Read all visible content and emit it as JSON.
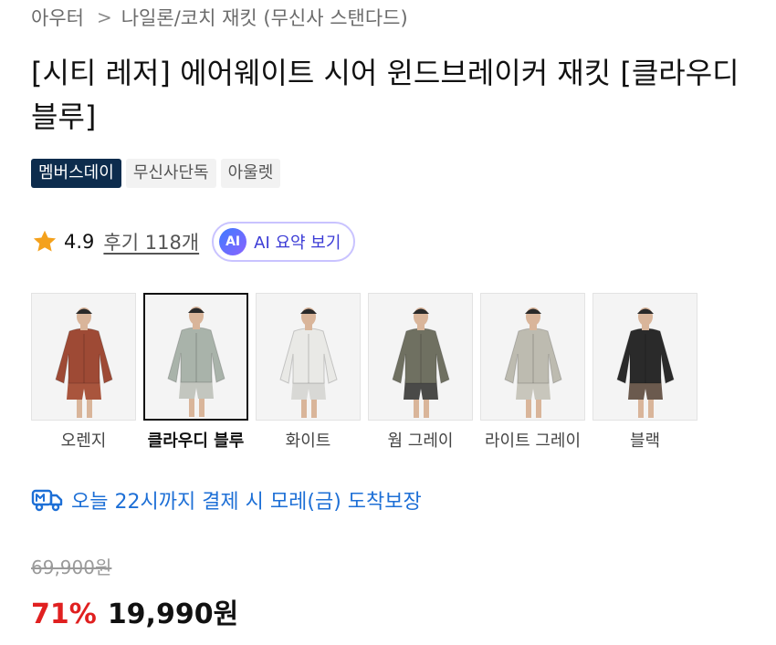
{
  "breadcrumb": {
    "category": "아우터",
    "subcategory": "나일론/코치 재킷 (무신사 스탠다드)"
  },
  "product": {
    "title": "[시티 레저] 에어웨이트 시어 윈드브레이커 재킷 [클라우디 블루]"
  },
  "badges": [
    "멤버스데이",
    "무신사단독",
    "아울렛"
  ],
  "rating": {
    "score": "4.9",
    "reviews_link": "후기 118개",
    "ai_badge": "AI",
    "ai_summary_label": "AI 요약 보기",
    "star_color": "#f4a11c"
  },
  "colors": [
    {
      "label": "오렌지",
      "jacket_color": "#9e4a35",
      "shorts_color": "#a9553d",
      "selected": false
    },
    {
      "label": "클라우디 블루",
      "jacket_color": "#a9b3aa",
      "shorts_color": "#c3c6bf",
      "selected": true
    },
    {
      "label": "화이트",
      "jacket_color": "#e9e9e6",
      "shorts_color": "#d8d8d5",
      "selected": false
    },
    {
      "label": "웜 그레이",
      "jacket_color": "#6f7061",
      "shorts_color": "#4a4a48",
      "selected": false
    },
    {
      "label": "라이트 그레이",
      "jacket_color": "#bdbbb0",
      "shorts_color": "#c8c6bc",
      "selected": false
    },
    {
      "label": "블랙",
      "jacket_color": "#2a2a2a",
      "shorts_color": "#6b5a4e",
      "selected": false
    }
  ],
  "delivery": {
    "text": "오늘 22시까지 결제 시 모레(금) 도착보장",
    "icon": "delivery-truck-icon",
    "color": "#1d6fd6"
  },
  "price": {
    "original": "69,900원",
    "discount": "71%",
    "final": "19,990원",
    "discount_color": "#e02020"
  }
}
